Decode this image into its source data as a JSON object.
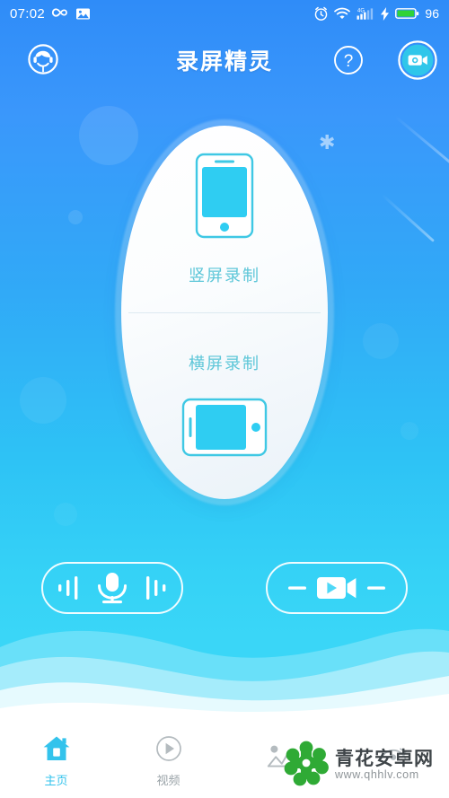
{
  "status_bar": {
    "time": "07:02",
    "icons_left": [
      "infinity-icon",
      "image-icon"
    ],
    "icons_right": [
      "alarm-icon",
      "wifi-icon",
      "signal-4g-icon",
      "charging-bolt-icon",
      "battery-icon"
    ],
    "network_label": "4G",
    "battery_percent": "96"
  },
  "header": {
    "title": "录屏精灵",
    "avatar_icon": "headset-avatar-icon",
    "help_icon": "help-question-icon",
    "help_label": "?",
    "record_icon": "video-camera-icon"
  },
  "modes": [
    {
      "label": "竖屏录制",
      "icon": "phone-portrait-icon"
    },
    {
      "label": "横屏录制",
      "icon": "phone-landscape-icon"
    }
  ],
  "actions": [
    {
      "name": "audio-record-button",
      "icon": "microphone-icon"
    },
    {
      "name": "video-record-button",
      "icon": "video-play-icon"
    }
  ],
  "nav": [
    {
      "label": "主页",
      "icon": "home-icon",
      "active": true
    },
    {
      "label": "视频",
      "icon": "play-circle-icon",
      "active": false
    },
    {
      "label": "",
      "icon": "image-mountain-icon",
      "active": false
    },
    {
      "label": "",
      "icon": "settings-icon",
      "active": false
    }
  ],
  "watermark": {
    "site_name": "青花安卓网",
    "url": "www.qhhlv.com"
  },
  "colors": {
    "bg_top": "#2f8cf8",
    "bg_bottom": "#3ad6f7",
    "accent_cyan": "#2fcdf2",
    "mode_text": "#5cc6d8",
    "nav_active": "#33c3ec",
    "nav_inactive": "#9aa3a8",
    "battery_green": "#2fd338",
    "watermark_green": "#2faa35"
  }
}
